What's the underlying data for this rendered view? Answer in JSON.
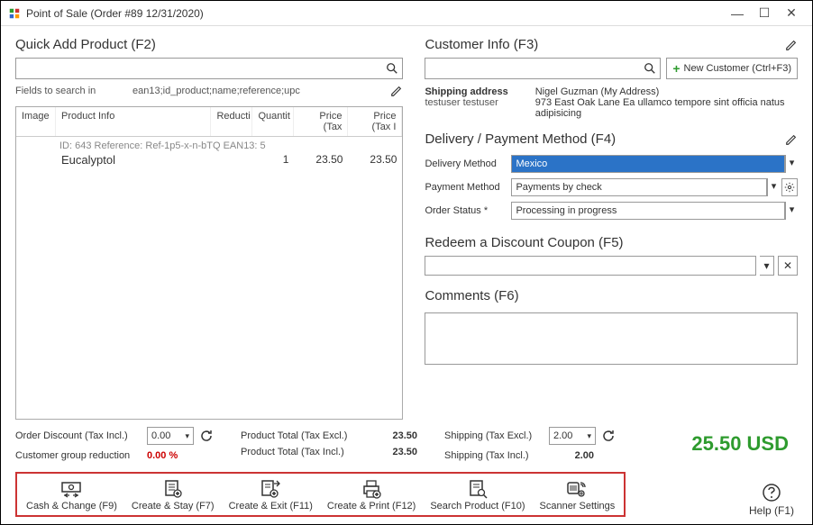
{
  "window": {
    "title": "Point of Sale (Order #89 12/31/2020)"
  },
  "left": {
    "quick_add_title": "Quick Add Product (F2)",
    "fields_label": "Fields to search in",
    "fields_value": "ean13;id_product;name;reference;upc",
    "grid": {
      "headers": {
        "image": "Image",
        "info": "Product Info",
        "reduction": "Reducti",
        "qty": "Quantit",
        "price_tax_excl": "Price (Tax",
        "price_tax_incl": "Price (Tax I"
      },
      "row": {
        "meta": "ID: 643 Reference: Ref-1p5-x-n-bTQ EAN13: 5",
        "name": "Eucalyptol",
        "qty": "1",
        "price_excl": "23.50",
        "price_incl": "23.50"
      }
    }
  },
  "right": {
    "customer_title": "Customer Info (F3)",
    "new_customer": "New Customer (Ctrl+F3)",
    "ship_addr_label": "Shipping address",
    "ship_user": "testuser testuser",
    "ship_name": "Nigel Guzman (My Address)",
    "ship_addr": "973 East Oak Lane Ea ullamco tempore sint officia natus adipisicing",
    "delivery_title": "Delivery / Payment Method (F4)",
    "delivery_method_label": "Delivery Method",
    "delivery_method_value": "Mexico",
    "payment_method_label": "Payment Method",
    "payment_method_value": "Payments by check",
    "order_status_label": "Order Status *",
    "order_status_value": "Processing in progress",
    "coupon_title": "Redeem a Discount Coupon (F5)",
    "comments_title": "Comments (F6)"
  },
  "totals": {
    "order_discount_label": "Order Discount (Tax Incl.)",
    "order_discount_value": "0.00",
    "cust_reduction_label": "Customer group reduction",
    "cust_reduction_value": "0.00 %",
    "prod_total_excl_label": "Product Total (Tax Excl.)",
    "prod_total_excl_value": "23.50",
    "prod_total_incl_label": "Product Total (Tax Incl.)",
    "prod_total_incl_value": "23.50",
    "shipping_excl_label": "Shipping (Tax Excl.)",
    "shipping_excl_value": "2.00",
    "shipping_incl_label": "Shipping (Tax Incl.)",
    "shipping_incl_value": "2.00",
    "grand_total": "25.50 USD"
  },
  "toolbar": {
    "cash_change": "Cash & Change (F9)",
    "create_stay": "Create & Stay (F7)",
    "create_exit": "Create & Exit (F11)",
    "create_print": "Create & Print (F12)",
    "search_product": "Search Product (F10)",
    "scanner_settings": "Scanner Settings"
  },
  "help_label": "Help (F1)"
}
